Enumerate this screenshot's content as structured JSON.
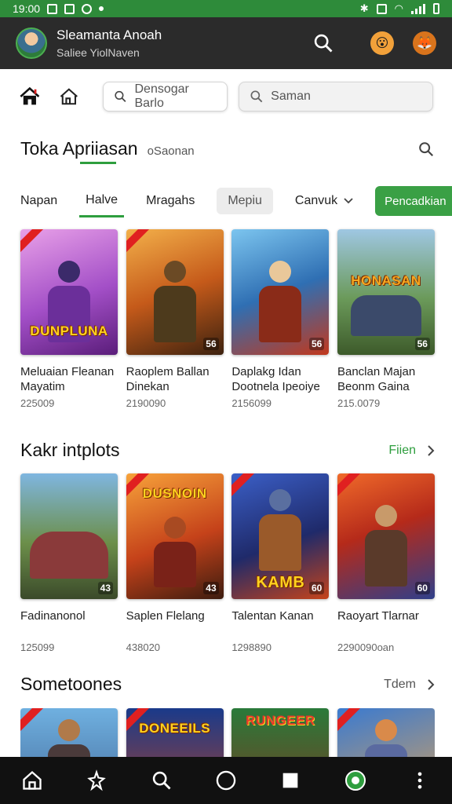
{
  "status_bar": {
    "time": "19:00"
  },
  "header": {
    "name": "Sleamanta Anoah",
    "subtitle": "Saliee YiolNaven"
  },
  "toolbar": {
    "search1": "Densogar Barlo",
    "search2": "Saman"
  },
  "main_section": {
    "title": "Toka Apriiasan",
    "subtitle": "oSaonan"
  },
  "tabs": [
    {
      "label": "Napan"
    },
    {
      "label": "Halve"
    },
    {
      "label": "Mragahs"
    },
    {
      "label": "Mepiu"
    },
    {
      "label": "Canvuk"
    }
  ],
  "primary_button": "Pencadkian",
  "row1": [
    {
      "title": "Meluaian Fleanan Mayatim",
      "count": "225009",
      "badge": "",
      "logo": "DUNPLUNA"
    },
    {
      "title": "Raoplem Ballan Dinekan",
      "count": "2190090",
      "badge": "56",
      "logo": ""
    },
    {
      "title": "Daplakg Idan Dootnela Ipeoiye",
      "count": "2156099",
      "badge": "56",
      "logo": ""
    },
    {
      "title": "Banclan Majan Beonm Gaina",
      "count": "215.0079",
      "badge": "56",
      "logo": "HONASAN"
    }
  ],
  "section2": {
    "title": "Kakr intplots",
    "more": "Fiien"
  },
  "row2": [
    {
      "title": "Fadinanonol",
      "count": "125099",
      "badge": "43",
      "logo": ""
    },
    {
      "title": "Saplen Flelang",
      "count": "438020",
      "badge": "43",
      "logo": "DUSNOIN"
    },
    {
      "title": "Talentan Kanan",
      "count": "1298890",
      "badge": "60",
      "logo": "KAMB"
    },
    {
      "title": "Raoyart Tlarnar",
      "count": "2290090oan",
      "badge": "60",
      "logo": ""
    }
  ],
  "section3": {
    "title": "Sometoones",
    "more": "Tdem"
  },
  "row3": [
    {
      "logo": ""
    },
    {
      "logo": "DONEEILS"
    },
    {
      "logo": "RUNGEER"
    },
    {
      "logo": ""
    }
  ]
}
